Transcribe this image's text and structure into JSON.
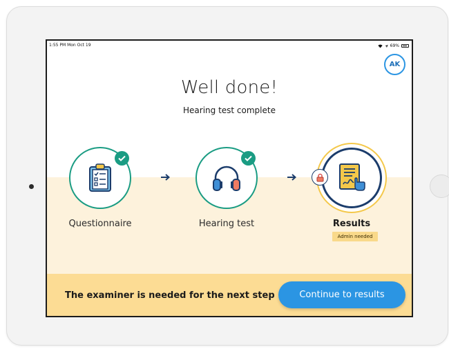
{
  "status_bar": {
    "time": "1:55 PM  Mon Oct 19",
    "battery": "69%"
  },
  "user": {
    "initials": "AK"
  },
  "header": {
    "title": "Well done!",
    "subtitle": "Hearing test complete"
  },
  "steps": [
    {
      "label": "Questionnaire",
      "icon": "clipboard-icon",
      "status": "complete"
    },
    {
      "label": "Hearing test",
      "icon": "headphones-icon",
      "status": "complete"
    },
    {
      "label": "Results",
      "icon": "signed-document-icon",
      "status": "locked",
      "badge": "Admin needed"
    }
  ],
  "footer": {
    "message": "The examiner is needed for the next step",
    "button_label": "Continue to results"
  },
  "colors": {
    "accent_blue": "#2b95e3",
    "complete_green": "#1a9c83",
    "navy": "#1b3c6b",
    "band_cream": "#fdf2dc",
    "footer_yellow": "#fcdc94"
  }
}
